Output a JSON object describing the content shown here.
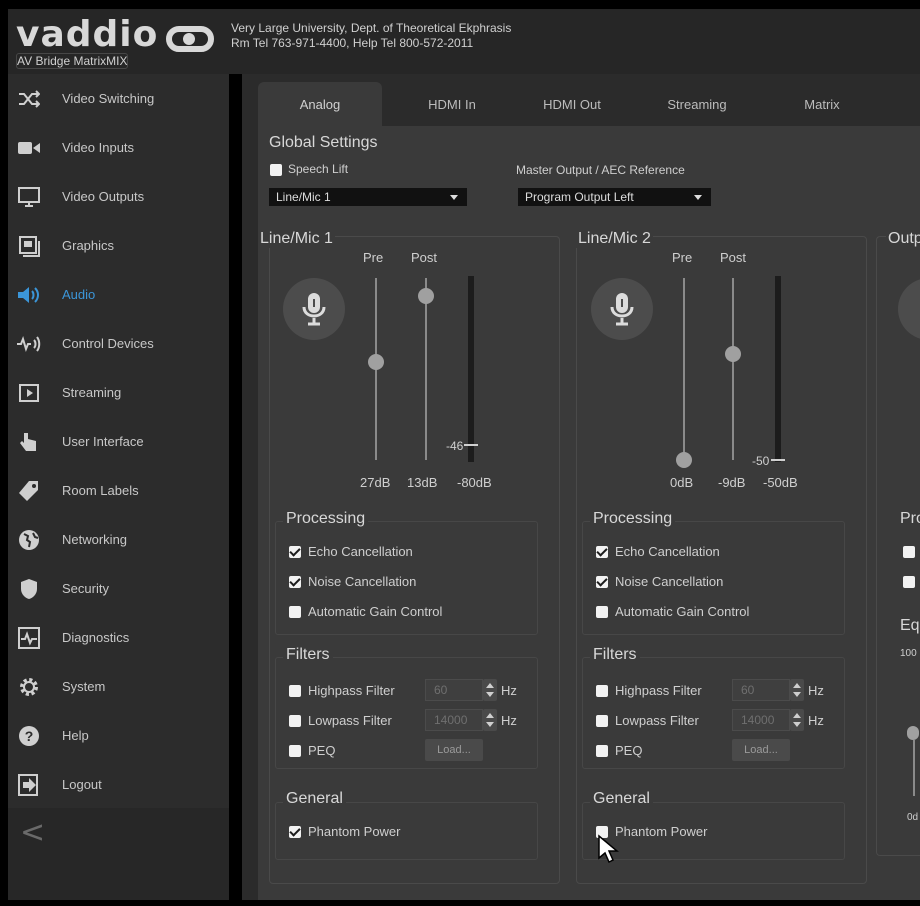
{
  "header": {
    "logo_text": "vaddio",
    "product": "AV Bridge MatrixMIX",
    "room_line": "Very Large University, Dept. of Theoretical Ekphrasis",
    "phone_line": "Rm Tel 763-971-4400, Help Tel 800-572-2011"
  },
  "sidebar": {
    "items": [
      {
        "label": "Video Switching",
        "icon": "video-switching-icon"
      },
      {
        "label": "Video Inputs",
        "icon": "camera-icon"
      },
      {
        "label": "Video Outputs",
        "icon": "monitor-icon"
      },
      {
        "label": "Graphics",
        "icon": "graphics-icon"
      },
      {
        "label": "Audio",
        "icon": "speaker-icon",
        "active": true
      },
      {
        "label": "Control Devices",
        "icon": "control-devices-icon"
      },
      {
        "label": "Streaming",
        "icon": "play-icon"
      },
      {
        "label": "User Interface",
        "icon": "hand-icon"
      },
      {
        "label": "Room Labels",
        "icon": "tag-icon"
      },
      {
        "label": "Networking",
        "icon": "globe-icon"
      },
      {
        "label": "Security",
        "icon": "shield-icon"
      },
      {
        "label": "Diagnostics",
        "icon": "pulse-icon"
      },
      {
        "label": "System",
        "icon": "gear-icon"
      },
      {
        "label": "Help",
        "icon": "help-icon"
      },
      {
        "label": "Logout",
        "icon": "logout-icon"
      }
    ],
    "collapse_glyph": "<",
    "active_color": "#3b96d9"
  },
  "tabs": [
    {
      "label": "Analog",
      "active": true
    },
    {
      "label": "HDMI In"
    },
    {
      "label": "HDMI Out"
    },
    {
      "label": "Streaming"
    },
    {
      "label": "Matrix"
    }
  ],
  "global": {
    "title": "Global Settings",
    "speech_lift_label": "Speech Lift",
    "speech_lift_checked": false,
    "speech_lift_source": "Line/Mic 1",
    "master_label": "Master Output / AEC Reference",
    "master_value": "Program Output Left"
  },
  "channels": [
    {
      "title": "Line/Mic 1",
      "pre_label": "Pre",
      "post_label": "Post",
      "pre_value": "27dB",
      "post_value": "13dB",
      "meter_value": "-80dB",
      "meter_marker": "-46",
      "processing_title": "Processing",
      "echo_label": "Echo Cancellation",
      "echo_checked": true,
      "noise_label": "Noise Cancellation",
      "noise_checked": true,
      "agc_label": "Automatic Gain Control",
      "agc_checked": false,
      "filters_title": "Filters",
      "highpass_label": "Highpass Filter",
      "highpass_value": "60",
      "highpass_unit": "Hz",
      "lowpass_label": "Lowpass Filter",
      "lowpass_value": "14000",
      "lowpass_unit": "Hz",
      "peq_label": "PEQ",
      "load_label": "Load...",
      "general_title": "General",
      "phantom_label": "Phantom Power",
      "phantom_checked": true
    },
    {
      "title": "Line/Mic 2",
      "pre_label": "Pre",
      "post_label": "Post",
      "pre_value": "0dB",
      "post_value": "-9dB",
      "meter_value": "-50dB",
      "meter_marker": "-50",
      "processing_title": "Processing",
      "echo_label": "Echo Cancellation",
      "echo_checked": true,
      "noise_label": "Noise Cancellation",
      "noise_checked": true,
      "agc_label": "Automatic Gain Control",
      "agc_checked": false,
      "filters_title": "Filters",
      "highpass_label": "Highpass Filter",
      "highpass_value": "60",
      "highpass_unit": "Hz",
      "lowpass_label": "Lowpass Filter",
      "lowpass_value": "14000",
      "lowpass_unit": "Hz",
      "peq_label": "PEQ",
      "load_label": "Load...",
      "general_title": "General",
      "phantom_label": "Phantom Power",
      "phantom_checked": false
    }
  ],
  "output_partial": {
    "title": "Outp",
    "processing": "Pro",
    "eq": "Eq",
    "eq_value": "100",
    "db": "0d"
  }
}
